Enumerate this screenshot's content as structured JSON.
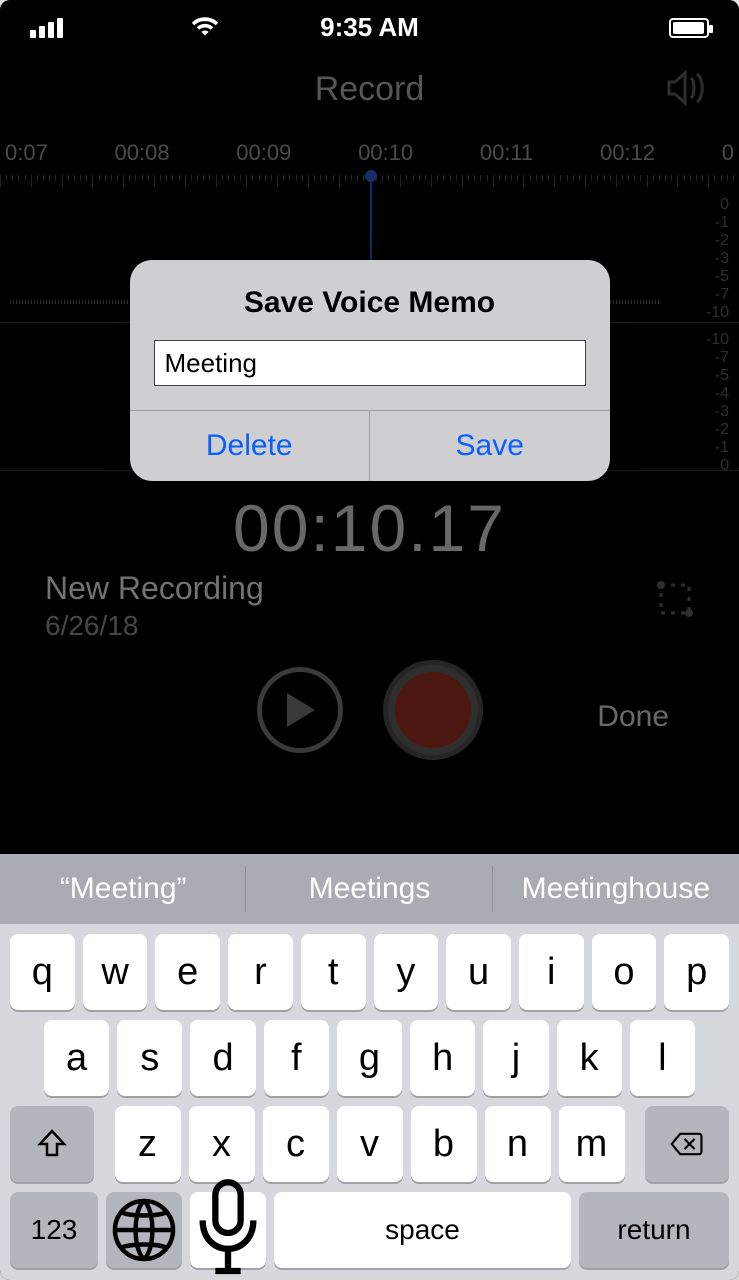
{
  "status": {
    "time": "9:35 AM"
  },
  "header": {
    "title": "Record"
  },
  "timeline": {
    "labels": [
      "0:07",
      "00:08",
      "00:09",
      "00:10",
      "00:11",
      "00:12",
      "0"
    ]
  },
  "db_scale_top": [
    "0",
    "-1",
    "-2",
    "-3",
    "-5",
    "-7",
    "-10"
  ],
  "db_scale_bottom": [
    "-10",
    "-7",
    "-5",
    "-4",
    "-3",
    "-2",
    "-1",
    "0"
  ],
  "elapsed": "00:10.17",
  "recording": {
    "title": "New Recording",
    "date": "6/26/18"
  },
  "controls": {
    "done": "Done"
  },
  "modal": {
    "title": "Save Voice Memo",
    "input_value": "Meeting",
    "delete": "Delete",
    "save": "Save"
  },
  "keyboard": {
    "predictions": [
      "“Meeting”",
      "Meetings",
      "Meetinghouse"
    ],
    "row1": [
      "q",
      "w",
      "e",
      "r",
      "t",
      "y",
      "u",
      "i",
      "o",
      "p"
    ],
    "row2": [
      "a",
      "s",
      "d",
      "f",
      "g",
      "h",
      "j",
      "k",
      "l"
    ],
    "row3": [
      "z",
      "x",
      "c",
      "v",
      "b",
      "n",
      "m"
    ],
    "numbers": "123",
    "space": "space",
    "return": "return"
  }
}
